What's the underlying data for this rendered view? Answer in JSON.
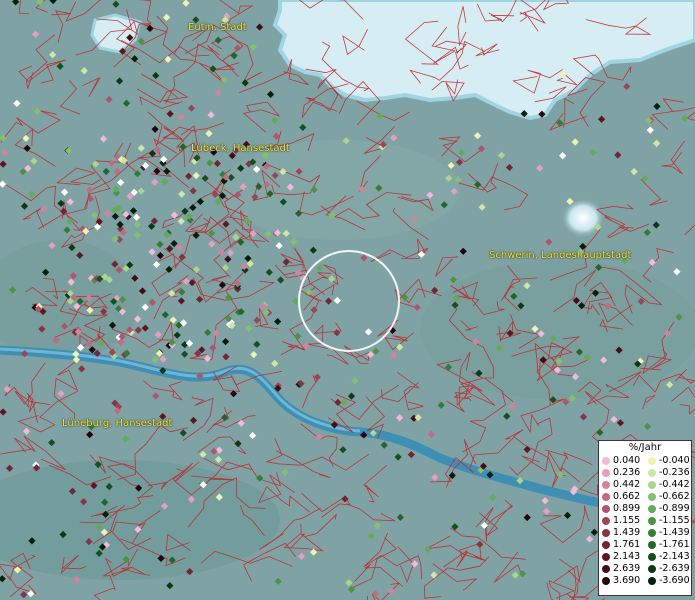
{
  "cities": [
    {
      "name": "Eutin, Stadt"
    },
    {
      "name": "Lübeck, Hansestadt"
    },
    {
      "name": "Schwerin, Landeshauptstadt"
    },
    {
      "name": "Lüneburg, Hansestadt"
    }
  ],
  "legend": {
    "title": "%/Jahr",
    "positive": [
      {
        "label": "0.040",
        "color": "#f1b9da"
      },
      {
        "label": "0.236",
        "color": "#e3a0c3"
      },
      {
        "label": "0.442",
        "color": "#d2839f"
      },
      {
        "label": "0.662",
        "color": "#bf6b84"
      },
      {
        "label": "0.899",
        "color": "#ad566e"
      },
      {
        "label": "1.155",
        "color": "#9a4659"
      },
      {
        "label": "1.439",
        "color": "#863546"
      },
      {
        "label": "1.761",
        "color": "#712634"
      },
      {
        "label": "2.143",
        "color": "#5b1823"
      },
      {
        "label": "2.639",
        "color": "#430d16"
      },
      {
        "label": "3.690",
        "color": "#22040a"
      }
    ],
    "negative": [
      {
        "label": "-0.040",
        "color": "#eef3b4"
      },
      {
        "label": "-0.236",
        "color": "#cfe7a4"
      },
      {
        "label": "-0.442",
        "color": "#aad68c"
      },
      {
        "label": "-0.662",
        "color": "#85c070"
      },
      {
        "label": "-0.899",
        "color": "#64aa58"
      },
      {
        "label": "-1.155",
        "color": "#4a9444"
      },
      {
        "label": "-1.439",
        "color": "#347d35"
      },
      {
        "label": "-1.761",
        "color": "#23662a"
      },
      {
        "label": "-2.143",
        "color": "#164f20"
      },
      {
        "label": "-2.639",
        "color": "#0b3815"
      },
      {
        "label": "-3.690",
        "color": "#02200a"
      }
    ]
  },
  "colors": {
    "land": "#7fa3a4",
    "sea": "#d9eef2",
    "river": "#3d8db0",
    "borders": "#c0282e",
    "selection_ring": "#ffffff"
  }
}
